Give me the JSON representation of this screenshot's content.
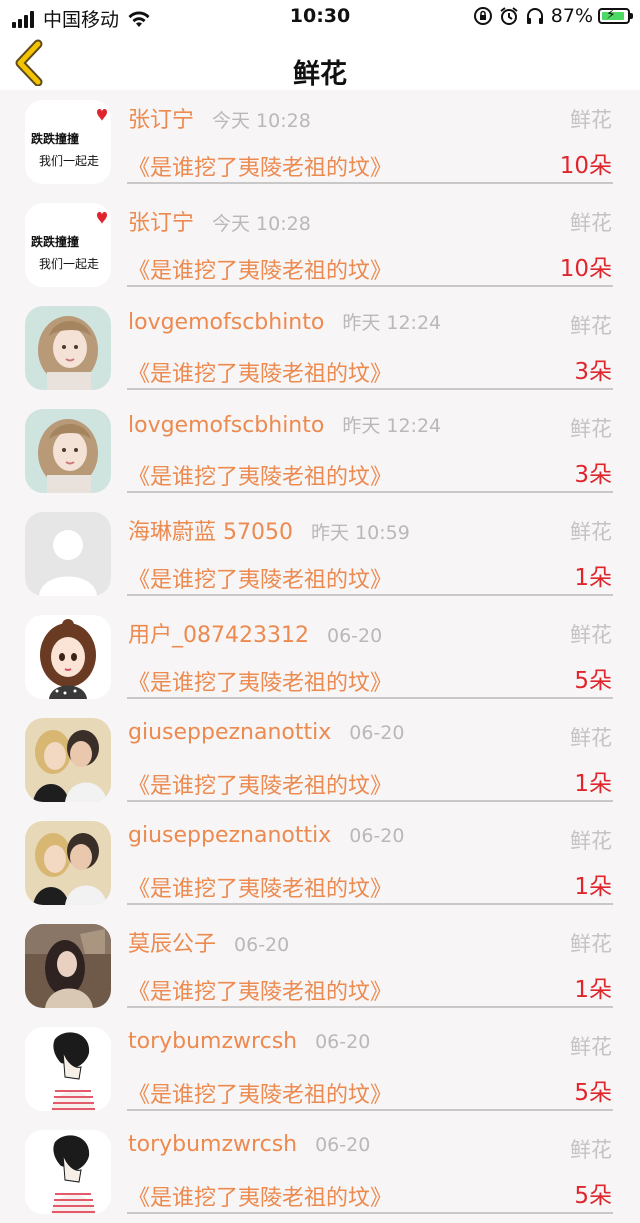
{
  "status_bar": {
    "carrier": "中国移动",
    "time": "10:30",
    "battery": "87%",
    "icons": [
      "signal-icon",
      "wifi-icon",
      "lock-rotation-icon",
      "alarm-icon",
      "headphones-icon",
      "battery-icon"
    ]
  },
  "nav": {
    "title": "鲜花",
    "back_icon": "chevron-left-icon"
  },
  "colors": {
    "accent": "#ec8a4f",
    "count": "#e0262d",
    "back": "#f5c400",
    "muted": "#b9b9b9"
  },
  "items": [
    {
      "user": "张订宁",
      "time": "今天 10:28",
      "category": "鲜花",
      "book": "《是谁挖了夷陵老祖的坟》",
      "count": "10朵",
      "avatar": {
        "type": "text",
        "lines": [
          "跌跌撞撞",
          "我们一起走"
        ]
      }
    },
    {
      "user": "张订宁",
      "time": "今天 10:28",
      "category": "鲜花",
      "book": "《是谁挖了夷陵老祖的坟》",
      "count": "10朵",
      "avatar": {
        "type": "text",
        "lines": [
          "跌跌撞撞",
          "我们一起走"
        ]
      }
    },
    {
      "user": "lovgemofscbhinto",
      "time": "昨天 12:24",
      "category": "鲜花",
      "book": "《是谁挖了夷陵老祖的坟》",
      "count": "3朵",
      "avatar": {
        "type": "girl"
      }
    },
    {
      "user": "lovgemofscbhinto",
      "time": "昨天 12:24",
      "category": "鲜花",
      "book": "《是谁挖了夷陵老祖的坟》",
      "count": "3朵",
      "avatar": {
        "type": "girl"
      }
    },
    {
      "user": "海琳蔚蓝 57050",
      "time": "昨天 10:59",
      "category": "鲜花",
      "book": "《是谁挖了夷陵老祖的坟》",
      "count": "1朵",
      "avatar": {
        "type": "default"
      }
    },
    {
      "user": "用户_087423312",
      "time": "06-20",
      "category": "鲜花",
      "book": "《是谁挖了夷陵老祖的坟》",
      "count": "5朵",
      "avatar": {
        "type": "cartoon"
      }
    },
    {
      "user": "giuseppeznanottix",
      "time": "06-20",
      "category": "鲜花",
      "book": "《是谁挖了夷陵老祖的坟》",
      "count": "1朵",
      "avatar": {
        "type": "couple"
      }
    },
    {
      "user": "giuseppeznanottix",
      "time": "06-20",
      "category": "鲜花",
      "book": "《是谁挖了夷陵老祖的坟》",
      "count": "1朵",
      "avatar": {
        "type": "couple"
      }
    },
    {
      "user": "莫辰公子",
      "time": "06-20",
      "category": "鲜花",
      "book": "《是谁挖了夷陵老祖的坟》",
      "count": "1朵",
      "avatar": {
        "type": "painting"
      }
    },
    {
      "user": "torybumzwrcsh",
      "time": "06-20",
      "category": "鲜花",
      "book": "《是谁挖了夷陵老祖的坟》",
      "count": "5朵",
      "avatar": {
        "type": "sketch"
      }
    },
    {
      "user": "torybumzwrcsh",
      "time": "06-20",
      "category": "鲜花",
      "book": "《是谁挖了夷陵老祖的坟》",
      "count": "5朵",
      "avatar": {
        "type": "sketch"
      }
    }
  ]
}
